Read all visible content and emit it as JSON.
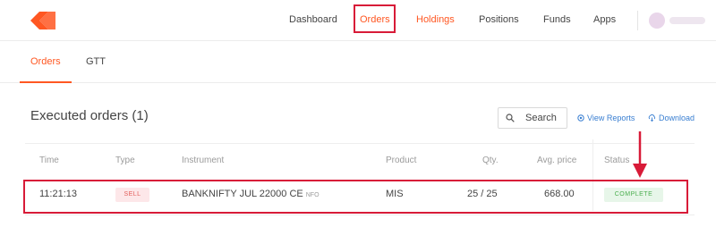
{
  "nav": {
    "items": [
      "Dashboard",
      "Orders",
      "Holdings",
      "Positions",
      "Funds",
      "Apps"
    ]
  },
  "subnav": {
    "tabs": [
      "Orders",
      "GTT"
    ]
  },
  "section": {
    "title": "Executed orders (1)",
    "search_label": "Search",
    "view_reports": "View Reports",
    "download": "Download"
  },
  "table": {
    "headers": [
      "Time",
      "Type",
      "Instrument",
      "Product",
      "Qty.",
      "Avg. price",
      "Status"
    ],
    "rows": [
      {
        "time": "11:21:13",
        "type": "SELL",
        "instrument": "BANKNIFTY JUL 22000 CE",
        "exchange": "NFO",
        "product": "MIS",
        "qty": "25 / 25",
        "avg_price": "668.00",
        "status": "COMPLETE"
      }
    ]
  },
  "colors": {
    "brand": "#ff5722",
    "highlight": "#d81b38",
    "link": "#387ed1",
    "sell": "#e25f5b",
    "complete": "#4caf50"
  },
  "icons": [
    "kite-logo-icon",
    "search-icon",
    "view-reports-icon",
    "download-icon",
    "annotation-arrow-icon"
  ]
}
